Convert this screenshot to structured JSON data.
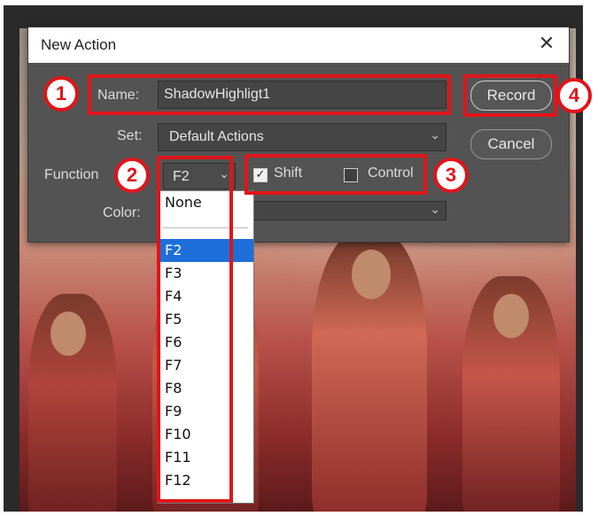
{
  "dialog": {
    "title": "New Action",
    "close_glyph": "✕",
    "name_label": "Name:",
    "name_value": "ShadowHighligt1",
    "set_label": "Set:",
    "set_value": "Default Actions",
    "function_label": "Function",
    "function_value": "F2",
    "shift_label": "Shift",
    "shift_checked": true,
    "control_label": "Control",
    "control_checked": false,
    "color_label": "Color:",
    "record_label": "Record",
    "cancel_label": "Cancel"
  },
  "function_dropdown": {
    "items": [
      "None",
      "F2",
      "F3",
      "F4",
      "F5",
      "F6",
      "F7",
      "F8",
      "F9",
      "F10",
      "F11",
      "F12"
    ],
    "selected": "F2"
  },
  "annotations": {
    "badges": [
      "1",
      "2",
      "3",
      "4"
    ],
    "color": "#e0141a"
  },
  "icons": {
    "chevron": "chevron-down-icon",
    "close": "close-icon",
    "checkmark": "checkmark-icon"
  }
}
